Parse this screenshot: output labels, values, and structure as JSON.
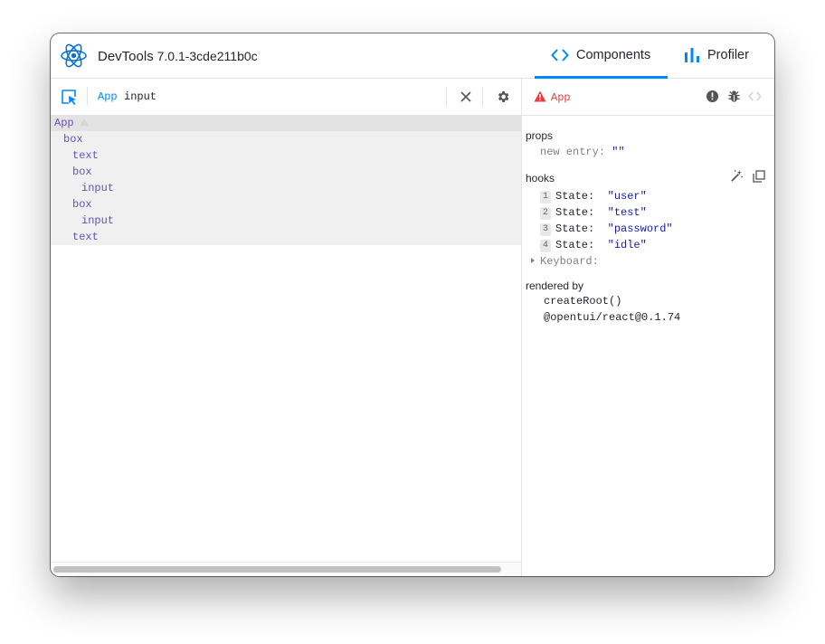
{
  "header": {
    "app_name": "DevTools",
    "version": "7.0.1-3cde211b0c",
    "tabs": [
      {
        "label": "Components",
        "icon": "code-brackets-icon",
        "active": true
      },
      {
        "label": "Profiler",
        "icon": "bar-chart-icon",
        "active": false
      }
    ]
  },
  "search": {
    "crumbs": [
      "App",
      "input"
    ]
  },
  "tree": {
    "rows": [
      {
        "label": "App",
        "depth": 0
      },
      {
        "label": "box",
        "depth": 1
      },
      {
        "label": "text",
        "depth": 2
      },
      {
        "label": "box",
        "depth": 2
      },
      {
        "label": "input",
        "depth": 3
      },
      {
        "label": "box",
        "depth": 2
      },
      {
        "label": "input",
        "depth": 3
      },
      {
        "label": "text",
        "depth": 2
      }
    ]
  },
  "inspector": {
    "component_name": "App",
    "props": {
      "title": "props",
      "items": [
        {
          "key": "new entry",
          "value": "\"\""
        }
      ]
    },
    "hooks": {
      "title": "hooks",
      "items": [
        {
          "index": "1",
          "label": "State:",
          "value": "\"user\""
        },
        {
          "index": "2",
          "label": "State:",
          "value": "\"test\""
        },
        {
          "index": "3",
          "label": "State:",
          "value": "\"password\""
        },
        {
          "index": "4",
          "label": "State:",
          "value": "\"idle\""
        }
      ],
      "collapsed": "Keyboard:"
    },
    "rendered_by": {
      "title": "rendered by",
      "items": [
        "createRoot()",
        "@opentui/react@0.1.74"
      ]
    }
  },
  "colors": {
    "accent": "#0088fa",
    "tree_text": "#6a51b2",
    "error": "#ef3a3a",
    "string": "#1a1aa6"
  }
}
